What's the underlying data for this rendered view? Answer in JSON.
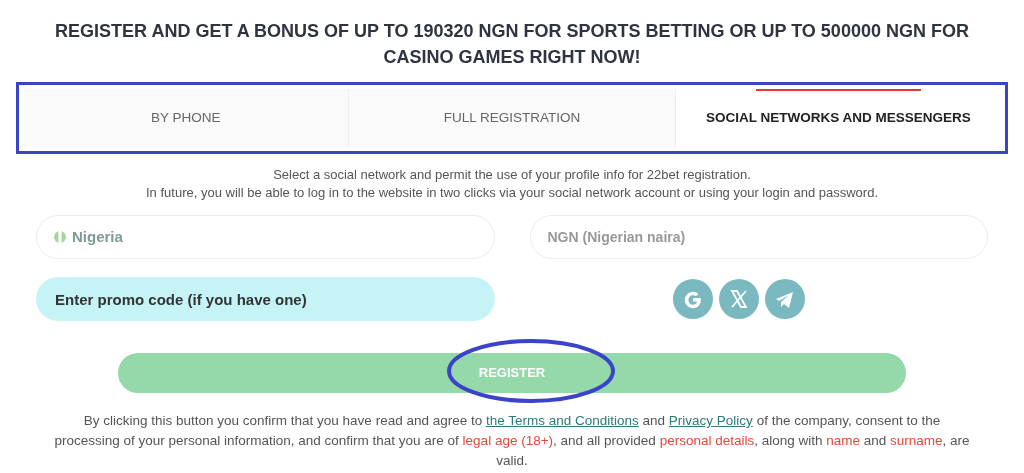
{
  "heading": "REGISTER AND GET A BONUS OF UP TO 190320 NGN FOR SPORTS BETTING OR UP TO 500000 NGN FOR CASINO GAMES RIGHT NOW!",
  "tabs": [
    {
      "label": "BY PHONE",
      "selected": false
    },
    {
      "label": "FULL REGISTRATION",
      "selected": false
    },
    {
      "label": "SOCIAL NETWORKS AND MESSENGERS",
      "selected": true
    }
  ],
  "description": [
    "Select a social network and permit the use of your profile info for 22bet registration.",
    "In future, you will be able to log in to the website in two clicks via your social network account or using your login and password."
  ],
  "country_field": {
    "value": "Nigeria"
  },
  "currency_field": {
    "value": "NGN (Nigerian naira)"
  },
  "promo_field": {
    "placeholder": "Enter promo code (if you have one)"
  },
  "social_buttons": [
    {
      "kind": "google"
    },
    {
      "kind": "x"
    },
    {
      "kind": "telegram"
    }
  ],
  "register_button": "REGISTER",
  "consent": [
    {
      "kind": "text",
      "text": "By clicking this button you confirm that you have read and agree to "
    },
    {
      "kind": "link",
      "text": "the Terms and Conditions"
    },
    {
      "kind": "text",
      "text": " and "
    },
    {
      "kind": "link",
      "text": "Privacy Policy"
    },
    {
      "kind": "text",
      "text": " of the company, consent to the processing of your personal information, and confirm that you are of "
    },
    {
      "kind": "highlight",
      "text": "legal age (18+)"
    },
    {
      "kind": "text",
      "text": ", and all provided "
    },
    {
      "kind": "highlight",
      "text": "personal details"
    },
    {
      "kind": "text",
      "text": ", along with "
    },
    {
      "kind": "highlight",
      "text": "name"
    },
    {
      "kind": "text",
      "text": " and "
    },
    {
      "kind": "highlight",
      "text": "surname"
    },
    {
      "kind": "text",
      "text": ", are valid."
    }
  ]
}
